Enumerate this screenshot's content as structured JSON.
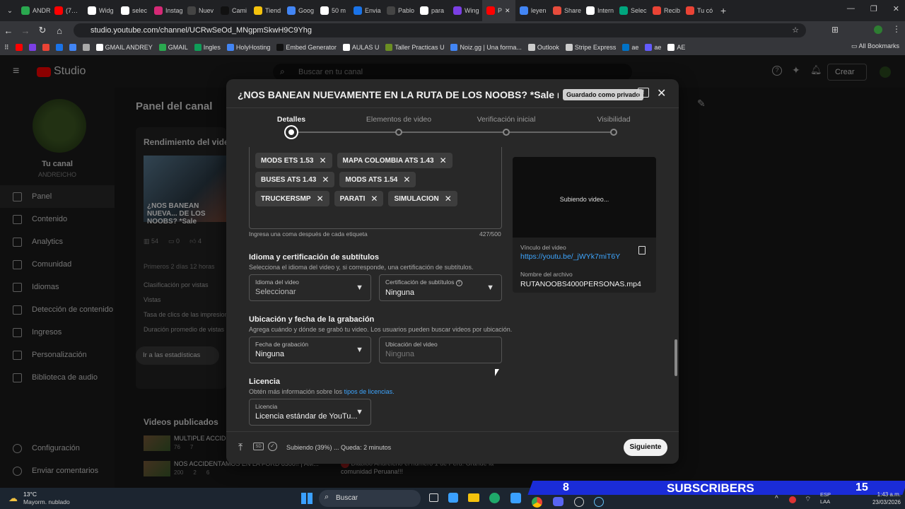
{
  "browser": {
    "tabs": [
      {
        "label": "ANDR",
        "color": "#2aa84f"
      },
      {
        "label": "(7…",
        "color": "#ff0000"
      },
      {
        "label": "Widg",
        "color": "#ffffff"
      },
      {
        "label": "selec",
        "color": "#ffffff"
      },
      {
        "label": "Instag",
        "color": "#d62976"
      },
      {
        "label": "Nuev",
        "color": "#444444"
      },
      {
        "label": "Cami",
        "color": "#111111"
      },
      {
        "label": "Tiend",
        "color": "#f4c20d"
      },
      {
        "label": "Goog",
        "color": "#4285f4"
      },
      {
        "label": "50 m",
        "color": "#ffffff"
      },
      {
        "label": "Envia",
        "color": "#1a73e8"
      },
      {
        "label": "Pablo",
        "color": "#444444"
      },
      {
        "label": "para",
        "color": "#ffffff"
      },
      {
        "label": "Wing",
        "color": "#7b3fe4"
      },
      {
        "label": "P",
        "color": "#ff0000"
      },
      {
        "label": "leyen",
        "color": "#4285f4"
      },
      {
        "label": "Share",
        "color": "#e74c3c"
      },
      {
        "label": "Intern",
        "color": "#ffffff"
      },
      {
        "label": "Selec",
        "color": "#00a67e"
      },
      {
        "label": "Recib",
        "color": "#ea4335"
      },
      {
        "label": "Tu có",
        "color": "#ea4335"
      }
    ],
    "url": "studio.youtube.com/channel/UCRwSeOd_MNgpmSkwH9C9Yhg",
    "bookmarks": [
      "GMAIL ANDREY",
      "GMAIL",
      "Ingles",
      "HolyHosting",
      "Embed Generator",
      "AULAS U",
      "Taller Practicas U",
      "Noiz.gg | Una forma...",
      "Outlook",
      "Stripe Express",
      "ae",
      "ae",
      "AE"
    ],
    "all_bookmarks": "All Bookmarks"
  },
  "studio": {
    "logo": "Studio",
    "search_placeholder": "Buscar en tu canal",
    "create_label": "Crear",
    "channel_label": "Tu canal",
    "channel_name": "ANDREICHO",
    "nav": [
      "Panel",
      "Contenido",
      "Analytics",
      "Comunidad",
      "Idiomas",
      "Detección de contenido",
      "Ingresos",
      "Personalización",
      "Biblioteca de audio"
    ],
    "nav_bottom": [
      "Configuración",
      "Enviar comentarios"
    ],
    "page_title": "Panel del canal",
    "perf_title": "Rendimiento del video",
    "video_title_bg": "¿NOS BANEAN NUEVA... DE LOS NOOBS? *Sale",
    "stats": [
      "54",
      "0",
      "4"
    ],
    "first_hours": "Primeros 2 días 12 horas",
    "metrics": [
      "Clasificación por vistas",
      "Vistas",
      "Tasa de clics de las impresiones",
      "Duración promedio de vistas"
    ],
    "stats_button": "Ir a las estadísticas",
    "published_title": "Videos publicados",
    "published": [
      {
        "title": "MULTIPLE ACCIDE...",
        "views": "76",
        "comments": "7"
      },
      {
        "title": "NOS ACCIDENTAMOS EN LA FORD 8300!! | AM...",
        "views": "200",
        "comments": "2",
        "likes": "6"
      }
    ],
    "comment_text": "Diabloo Andreicho el numero 1 de Peru. Grande la comunidad Peruana!!!"
  },
  "modal": {
    "title": "¿NOS BANEAN NUEVAMENTE EN LA RUTA DE LOS NOOBS? *Sale mal* | ...",
    "saved_badge": "Guardado como privado",
    "steps": [
      "Detalles",
      "Elementos de video",
      "Verificación inicial",
      "Visibilidad"
    ],
    "tags": [
      "MODS ETS 1.53",
      "MAPA COLOMBIA ATS 1.43",
      "BUSES ATS 1.43",
      "MODS ATS 1.54",
      "TRUCKERSMP",
      "PARATI",
      "SIMULACION"
    ],
    "tags_hint": "Ingresa una coma después de cada etiqueta",
    "tags_count": "427/500",
    "lang_section": {
      "title": "Idioma y certificación de subtítulos",
      "desc": "Selecciona el idioma del video y, si corresponde, una certificación de subtítulos.",
      "lang_label": "Idioma del video",
      "lang_value": "Seleccionar",
      "cert_label": "Certificación de subtítulos",
      "cert_value": "Ninguna"
    },
    "loc_section": {
      "title": "Ubicación y fecha de la grabación",
      "desc": "Agrega cuándo y dónde se grabó tu video. Los usuarios pueden buscar videos por ubicación.",
      "date_label": "Fecha de grabación",
      "date_value": "Ninguna",
      "loc_label": "Ubicación del video",
      "loc_placeholder": "Ninguna"
    },
    "license_section": {
      "title": "Licencia",
      "desc": "Obtén más información sobre los",
      "link": "tipos de licencias.",
      "label": "Licencia",
      "value": "Licencia estándar de YouTu..."
    },
    "preview": {
      "uploading": "Subiendo video...",
      "link_label": "Vínculo del video",
      "link": "https://youtu.be/_jWYk7miT6Y",
      "file_label": "Nombre del archivo",
      "file": "RUTANOOBS4000PERSONAS.mp4"
    },
    "footer_status": "Subiendo (39%) ... Queda: 2 minutos",
    "next_button": "Siguiente"
  },
  "taskbar": {
    "temp": "13°C",
    "weather": "Mayorm. nublado",
    "search": "Buscar",
    "subs_left": "8",
    "subs_label": "SUBSCRIBERS",
    "subs_right": "15",
    "lang1": "ESP",
    "lang2": "LAA",
    "time": "1:43 a.m.",
    "date": "23/03/2026"
  },
  "colors": {
    "accent": "#3ea6ff",
    "brand": "#ff0000",
    "subs_banner": "#1a2cd8"
  }
}
